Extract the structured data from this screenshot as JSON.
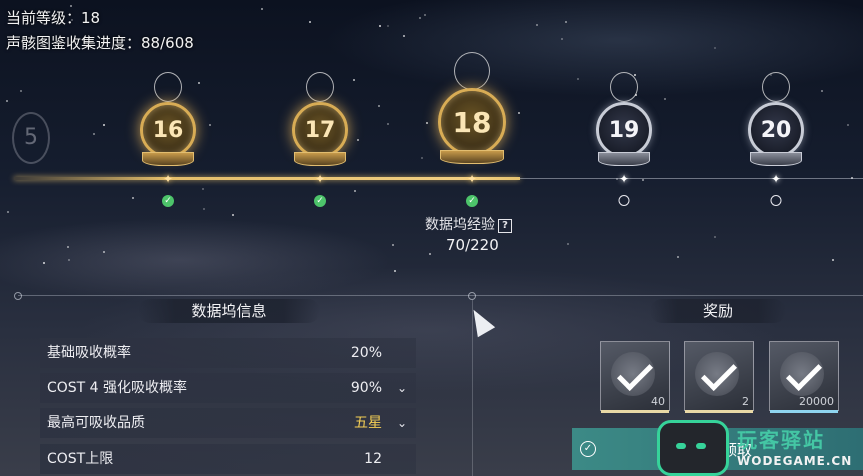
{
  "header": {
    "level_label": "当前等级：",
    "level_value": "18",
    "collection_label": "声骸图鉴收集进度：",
    "collection_value": "88/608"
  },
  "levels": [
    {
      "number": "16",
      "state": "claimed"
    },
    {
      "number": "17",
      "state": "claimed"
    },
    {
      "number": "18",
      "state": "claimed"
    },
    {
      "number": "19",
      "state": "locked"
    },
    {
      "number": "20",
      "state": "locked"
    }
  ],
  "ghost_level": "5",
  "experience": {
    "label": "数据坞经验",
    "help_icon": "?",
    "value": "70/220"
  },
  "info_section": {
    "title": "数据坞信息",
    "rows": [
      {
        "label": "基础吸收概率",
        "value": "20%",
        "has_dropdown": false
      },
      {
        "label": "COST 4 强化吸收概率",
        "value": "90%",
        "has_dropdown": true
      },
      {
        "label": "最高可吸收品质",
        "value": "五星",
        "has_dropdown": true,
        "highlight": "#f5cf55"
      },
      {
        "label": "COST上限",
        "value": "12",
        "has_dropdown": false
      }
    ]
  },
  "reward_section": {
    "title": "奖励",
    "items": [
      {
        "quantity": "40",
        "icon": "echo-material-icon",
        "base_color": "#e9d9a6"
      },
      {
        "quantity": "2",
        "icon": "tuning-module-icon",
        "base_color": "#e9d9a6"
      },
      {
        "quantity": "20000",
        "icon": "shell-credit-icon",
        "base_color": "#8fd5f0"
      }
    ]
  },
  "claim": {
    "label": "已领取"
  },
  "watermark": {
    "cn": "玩客驿站",
    "en": "WODEGAME.CN"
  },
  "colors": {
    "gold": "#d8ac55",
    "claim_green": "#4dc46a",
    "accent_teal": "#36d39a"
  }
}
